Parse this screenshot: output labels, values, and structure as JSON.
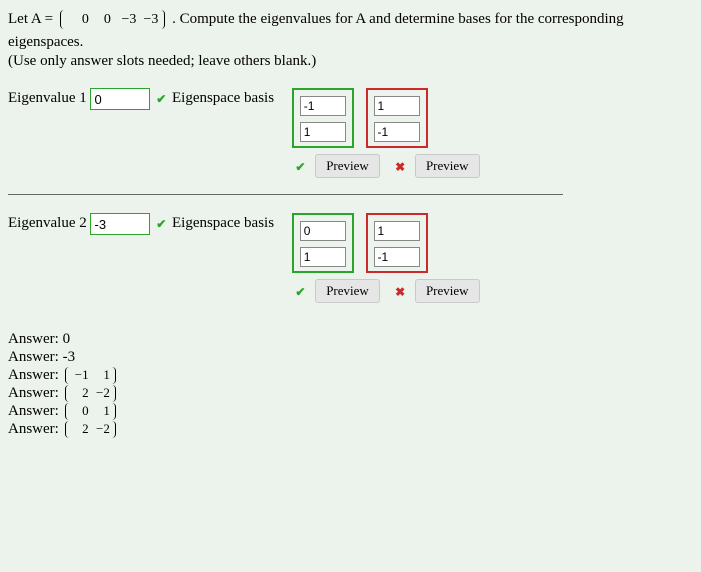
{
  "question": {
    "prefix": "Let A = ",
    "matrixA": [
      [
        "0",
        "0"
      ],
      [
        "−3",
        "−3"
      ]
    ],
    "suffix": " . Compute the eigenvalues for A and determine bases for the corresponding eigenspaces.",
    "instruction": "(Use only answer slots needed; leave others blank.)"
  },
  "labels": {
    "eigenvalue1": "Eigenvalue 1",
    "eigenvalue2": "Eigenvalue 2",
    "eigenspaceBasis": "Eigenspace basis",
    "preview": "Preview",
    "answerPrefix": "Answer:"
  },
  "inputs": {
    "eig1": {
      "value": "0",
      "status": "correct"
    },
    "eig2": {
      "value": "-3",
      "status": "correct"
    },
    "basis1": {
      "v1": {
        "top": "-1",
        "bot": "1",
        "status": "correct"
      },
      "v2": {
        "top": "1",
        "bot": "-1",
        "status": "incorrect"
      }
    },
    "basis2": {
      "v1": {
        "top": "0",
        "bot": "1",
        "status": "correct"
      },
      "v2": {
        "top": "1",
        "bot": "-1",
        "status": "incorrect"
      }
    }
  },
  "answers": [
    {
      "type": "scalar",
      "value": "0"
    },
    {
      "type": "scalar",
      "value": "-3"
    },
    {
      "type": "vector",
      "value": [
        [
          "−1"
        ],
        [
          "1"
        ]
      ]
    },
    {
      "type": "vector",
      "value": [
        [
          "2"
        ],
        [
          "−2"
        ]
      ]
    },
    {
      "type": "vector",
      "value": [
        [
          "0"
        ],
        [
          "1"
        ]
      ]
    },
    {
      "type": "vector",
      "value": [
        [
          "2"
        ],
        [
          "−2"
        ]
      ]
    }
  ]
}
